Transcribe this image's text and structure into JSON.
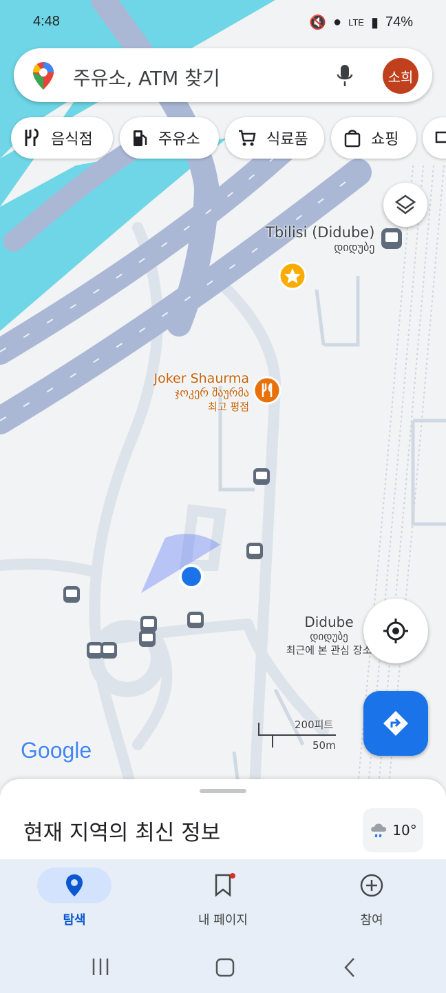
{
  "status": {
    "time": "4:48",
    "network": "LTE",
    "battery": "74%"
  },
  "search": {
    "placeholder": "주유소, ATM 찾기",
    "avatar_text": "소희"
  },
  "chips": [
    {
      "label": "음식점",
      "icon": "restaurant-icon"
    },
    {
      "label": "주유소",
      "icon": "gas-station-icon"
    },
    {
      "label": "식료품",
      "icon": "cart-icon"
    },
    {
      "label": "쇼핑",
      "icon": "shopping-bag-icon"
    }
  ],
  "map": {
    "places": {
      "tbilisi_station": {
        "name": "Tbilisi (Didube)",
        "local": "დიდუბე"
      },
      "joker": {
        "name": "Joker Shaurma",
        "local": "ჯოკერ შაურმა",
        "note": "최고 평점"
      },
      "didube": {
        "name": "Didube",
        "local": "დიდუბე",
        "note": "최근에 본 관심 장소"
      }
    },
    "scale": {
      "feet": "200피트",
      "meters": "50m"
    },
    "logo": "Google"
  },
  "sheet": {
    "title": "현재 지역의 최신 정보",
    "temperature": "10°"
  },
  "bottom_nav": [
    {
      "label": "탐색",
      "icon": "location-pin-icon",
      "active": true
    },
    {
      "label": "내 페이지",
      "icon": "bookmark-icon",
      "active": false
    },
    {
      "label": "참여",
      "icon": "add-circle-icon",
      "active": false
    }
  ],
  "colors": {
    "accent": "#1a73e8",
    "water": "#5ed3e6",
    "highway": "#aab8d6",
    "food": "#e8710a",
    "avatar": "#c0401e"
  }
}
